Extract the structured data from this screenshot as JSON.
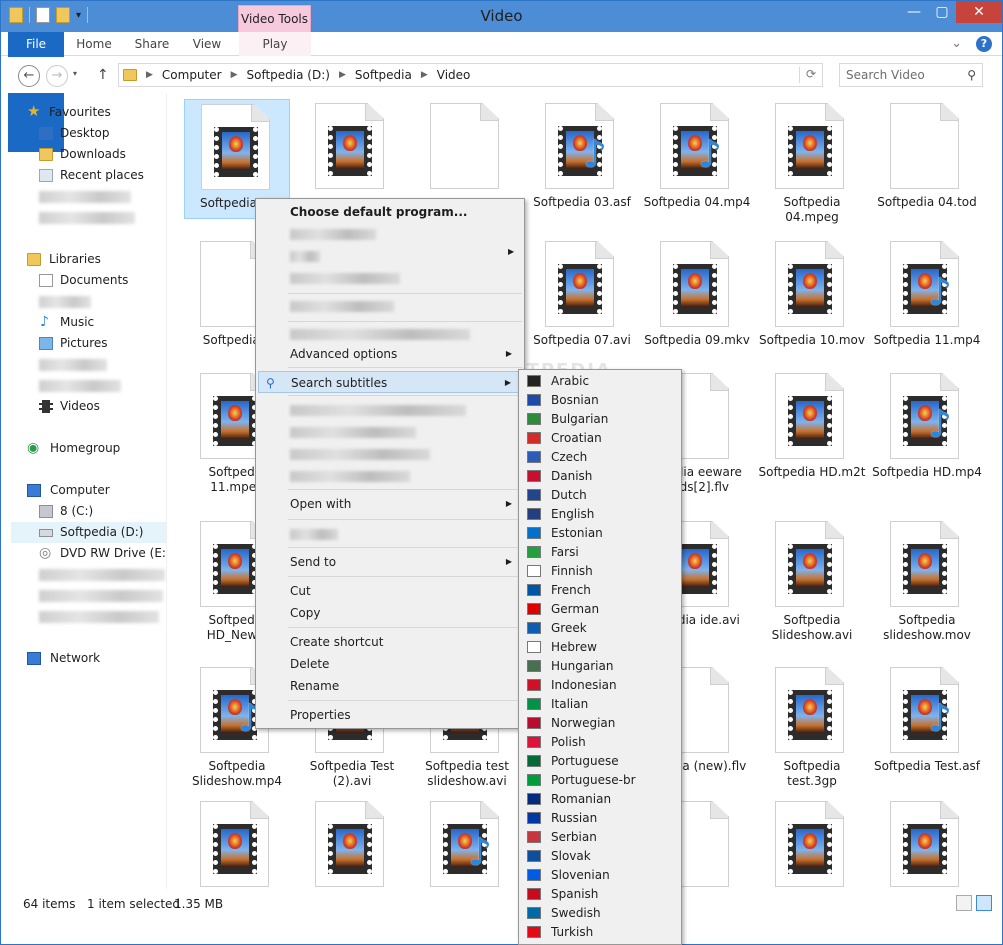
{
  "window": {
    "title": "Video"
  },
  "ribbon": {
    "context_group": "Video Tools",
    "tabs": [
      "File",
      "Home",
      "Share",
      "View",
      "Play"
    ]
  },
  "address": {
    "crumbs": [
      "Computer",
      "Softpedia (D:)",
      "Softpedia",
      "Video"
    ],
    "search_placeholder": "Search Video"
  },
  "nav": {
    "favourites": "Favourites",
    "desktop": "Desktop",
    "downloads": "Downloads",
    "recent": "Recent places",
    "libraries": "Libraries",
    "documents": "Documents",
    "music": "Music",
    "pictures": "Pictures",
    "videos": "Videos",
    "homegroup": "Homegroup",
    "computer": "Computer",
    "drive_c": "8 (C:)",
    "drive_d": "Softpedia (D:)",
    "drive_e": "DVD RW Drive (E:) D",
    "network": "Network"
  },
  "files": [
    {
      "name": "Softpedia 01",
      "kind": "film"
    },
    {
      "name": "",
      "kind": "film"
    },
    {
      "name": "",
      "kind": "blank"
    },
    {
      "name": "Softpedia 03.asf",
      "kind": "audio"
    },
    {
      "name": "Softpedia 04.mp4",
      "kind": "audio"
    },
    {
      "name": "Softpedia 04.mpeg",
      "kind": "film"
    },
    {
      "name": "Softpedia 04.tod",
      "kind": "blank"
    },
    {
      "name": "Softpedia 0",
      "kind": "blank"
    },
    {
      "name": "",
      "kind": "none"
    },
    {
      "name": "",
      "kind": "none"
    },
    {
      "name": "Softpedia 07.avi",
      "kind": "film"
    },
    {
      "name": "Softpedia 09.mkv",
      "kind": "film"
    },
    {
      "name": "Softpedia 10.mov",
      "kind": "film"
    },
    {
      "name": "Softpedia 11.mp4",
      "kind": "audio"
    },
    {
      "name": "Softpedia 11.mpeg",
      "kind": "film"
    },
    {
      "name": "",
      "kind": "none"
    },
    {
      "name": "",
      "kind": "none"
    },
    {
      "name": "",
      "kind": "none"
    },
    {
      "name": "ftpedia eeware oads[2].flv",
      "kind": "blank"
    },
    {
      "name": "Softpedia HD.m2t",
      "kind": "film"
    },
    {
      "name": "Softpedia HD.mp4",
      "kind": "audio"
    },
    {
      "name": "Softpedia HD_New.a",
      "kind": "film"
    },
    {
      "name": "",
      "kind": "none"
    },
    {
      "name": "",
      "kind": "none"
    },
    {
      "name": "",
      "kind": "none"
    },
    {
      "name": "ftpedia ide.avi",
      "kind": "film"
    },
    {
      "name": "Softpedia Slideshow.avi",
      "kind": "film"
    },
    {
      "name": "Softpedia slideshow.mov",
      "kind": "film"
    },
    {
      "name": "Softpedia Slideshow.mp4",
      "kind": "audio"
    },
    {
      "name": "Softpedia Test (2).avi",
      "kind": "film"
    },
    {
      "name": "Softpedia test slideshow.avi",
      "kind": "film"
    },
    {
      "name": "",
      "kind": "none"
    },
    {
      "name": "ftpedia (new).flv",
      "kind": "blank"
    },
    {
      "name": "Softpedia test.3gp",
      "kind": "film"
    },
    {
      "name": "Softpedia Test.asf",
      "kind": "audio"
    },
    {
      "name": "",
      "kind": "film"
    },
    {
      "name": "",
      "kind": "film"
    },
    {
      "name": "",
      "kind": "audio"
    },
    {
      "name": "",
      "kind": "none"
    },
    {
      "name": "",
      "kind": "blank"
    },
    {
      "name": "",
      "kind": "film"
    },
    {
      "name": "",
      "kind": "film"
    }
  ],
  "context_menu": {
    "choose_default": "Choose default program...",
    "advanced": "Advanced options",
    "search_subtitles": "Search subtitles",
    "open_with": "Open with",
    "send_to": "Send to",
    "cut": "Cut",
    "copy": "Copy",
    "create_shortcut": "Create shortcut",
    "delete": "Delete",
    "rename": "Rename",
    "properties": "Properties"
  },
  "languages": [
    {
      "name": "Arabic",
      "flag": "#222"
    },
    {
      "name": "Bosnian",
      "flag": "#1f4aa8"
    },
    {
      "name": "Bulgarian",
      "flag": "#2e8b3c"
    },
    {
      "name": "Croatian",
      "flag": "#d32a2a"
    },
    {
      "name": "Czech",
      "flag": "#2a5cb8"
    },
    {
      "name": "Danish",
      "flag": "#c8102e"
    },
    {
      "name": "Dutch",
      "flag": "#21468b"
    },
    {
      "name": "English",
      "flag": "#22407f"
    },
    {
      "name": "Estonian",
      "flag": "#0072ce"
    },
    {
      "name": "Farsi",
      "flag": "#239f40"
    },
    {
      "name": "Finnish",
      "flag": "#fff"
    },
    {
      "name": "French",
      "flag": "#0055a4"
    },
    {
      "name": "German",
      "flag": "#dd0000"
    },
    {
      "name": "Greek",
      "flag": "#0d5eaf"
    },
    {
      "name": "Hebrew",
      "flag": "#fff"
    },
    {
      "name": "Hungarian",
      "flag": "#477050"
    },
    {
      "name": "Indonesian",
      "flag": "#ce1126"
    },
    {
      "name": "Italian",
      "flag": "#009246"
    },
    {
      "name": "Norwegian",
      "flag": "#ba0c2f"
    },
    {
      "name": "Polish",
      "flag": "#dc143c"
    },
    {
      "name": "Portuguese",
      "flag": "#046a38"
    },
    {
      "name": "Portuguese-br",
      "flag": "#009c3b"
    },
    {
      "name": "Romanian",
      "flag": "#002b7f"
    },
    {
      "name": "Russian",
      "flag": "#0039a6"
    },
    {
      "name": "Serbian",
      "flag": "#c6363c"
    },
    {
      "name": "Slovak",
      "flag": "#0b4ea2"
    },
    {
      "name": "Slovenian",
      "flag": "#005ce5"
    },
    {
      "name": "Spanish",
      "flag": "#c60b1e"
    },
    {
      "name": "Swedish",
      "flag": "#006aa7"
    },
    {
      "name": "Turkish",
      "flag": "#e30a17"
    }
  ],
  "status": {
    "items": "64 items",
    "selected": "1 item selected",
    "size": "1.35 MB"
  },
  "watermark": "SOFTPEDIA"
}
